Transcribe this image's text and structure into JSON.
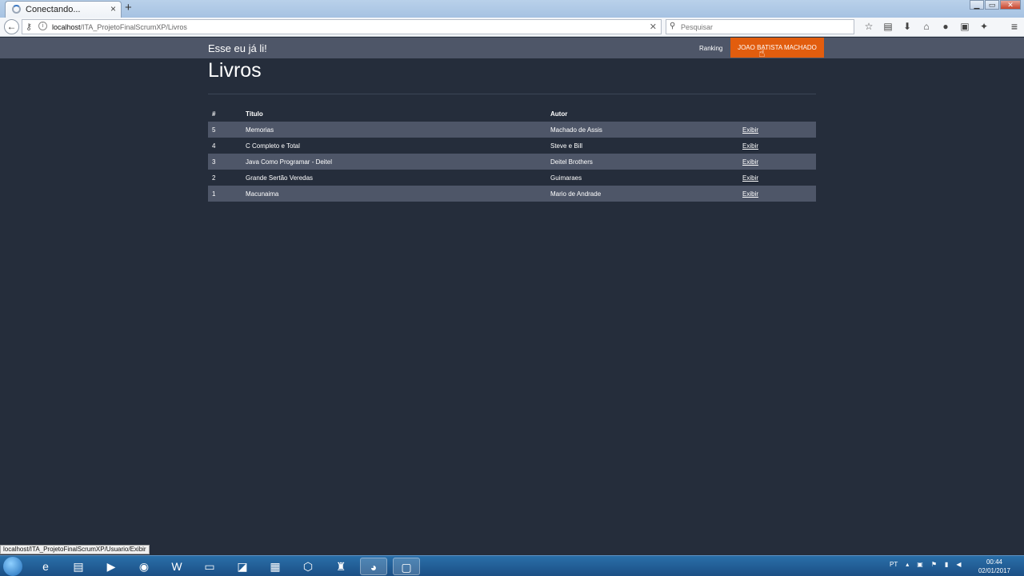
{
  "browser": {
    "tab_title": "Conectando...",
    "tab_close": "×",
    "new_tab": "+",
    "url_host": "localhost",
    "url_path": "/ITA_ProjetoFinalScrumXP/Livros",
    "search_placeholder": "Pesquisar",
    "icons": [
      "bookmark-star-icon",
      "reading-list-icon",
      "download-icon",
      "home-icon",
      "chat-icon",
      "screenshot-icon",
      "extension-icon",
      "menu-icon"
    ]
  },
  "site": {
    "brand": "Esse eu já li!",
    "nav": {
      "ranking": "Ranking",
      "user": "JOAO BATISTA MACHADO"
    },
    "page_title": "Livros",
    "table": {
      "headers": {
        "num": "#",
        "title": "Título",
        "author": "Autor"
      },
      "action_label": "Exibir",
      "rows": [
        {
          "num": "5",
          "title": "Memorias",
          "author": "Machado de Assis"
        },
        {
          "num": "4",
          "title": "C Completo e Total",
          "author": "Steve e Bill"
        },
        {
          "num": "3",
          "title": "Java Como Programar - Deitel",
          "author": "Deitel Brothers"
        },
        {
          "num": "2",
          "title": "Grande Sertão Veredas",
          "author": "Guimaraes"
        },
        {
          "num": "1",
          "title": "Macunaima",
          "author": "Mario de Andrade"
        }
      ]
    }
  },
  "status_bar": "localhost/ITA_ProjetoFinalScrumXP/Usuario/Exibir",
  "taskbar": {
    "language": "PT",
    "time": "00:44",
    "date": "02/01/2017"
  },
  "colors": {
    "page_bg": "#252d3b",
    "nav_bg": "#4e5668",
    "accent": "#e25d0e"
  }
}
